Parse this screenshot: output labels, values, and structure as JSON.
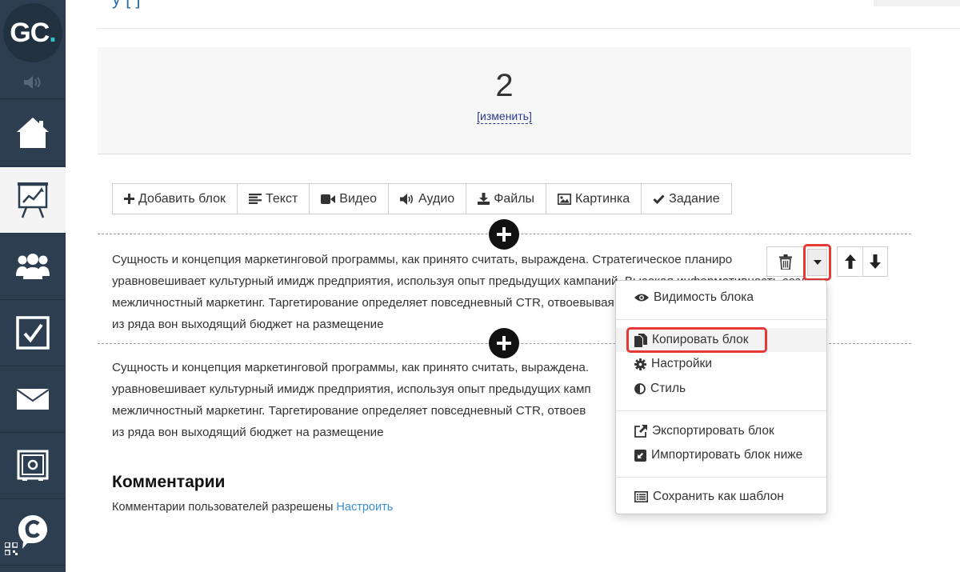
{
  "sidebar": {
    "logo_letters": "GC",
    "logo_dot": ".",
    "items": [
      {
        "name": "home",
        "icon": "home-icon"
      },
      {
        "name": "training",
        "icon": "presentation-chart-icon",
        "active": true
      },
      {
        "name": "users",
        "icon": "users-icon"
      },
      {
        "name": "tasks",
        "icon": "checkbox-icon"
      },
      {
        "name": "messages",
        "icon": "envelope-icon"
      },
      {
        "name": "safe",
        "icon": "safe-icon"
      },
      {
        "name": "chat",
        "icon": "chat-c-icon"
      }
    ]
  },
  "header": {
    "title_fragment": "у            [            ]"
  },
  "number_panel": {
    "value": "2",
    "change_link": "[изменить]"
  },
  "toolbar": {
    "buttons": [
      {
        "icon": "plus-icon",
        "label": "Добавить блок"
      },
      {
        "icon": "text-lines-icon",
        "label": "Текст"
      },
      {
        "icon": "video-camera-icon",
        "label": "Видео"
      },
      {
        "icon": "volume-icon",
        "label": "Аудио"
      },
      {
        "icon": "download-icon",
        "label": "Файлы"
      },
      {
        "icon": "image-icon",
        "label": "Картинка"
      },
      {
        "icon": "check-icon",
        "label": "Задание"
      }
    ]
  },
  "blocks": [
    {
      "lines": [
        "Сущность и концепция маркетинговой программы, как принято считать, выраждена. Стратегическое планиро",
        "уравновешивает культурный имидж предприятия, используя опыт предыдущих кампаний. Высокая информативность создает",
        "межличностный маркетинг. Таргетирование определяет повседневный CTR, отвоевывая рыночный сегмент рынка и искажает",
        "из ряда вон выходящий бюджет на размещение"
      ]
    },
    {
      "lines": [
        "Сущность и концепция маркетинговой программы, как принято считать, выраждена.",
        "уравновешивает культурный имидж предприятия, используя опыт предыдущих камп                                        оздает",
        "межличностный маркетинг. Таргетирование определяет повседневный CTR, отвоев                                        и искажает",
        "из ряда вон выходящий бюджет на размещение"
      ]
    }
  ],
  "block_menu": {
    "items": [
      {
        "icon": "eye-icon",
        "label": "Видимость блока"
      },
      {
        "icon": "copy-file-icon",
        "label": "Копировать блок",
        "highlighted": true
      },
      {
        "icon": "gear-icon",
        "label": "Настройки"
      },
      {
        "icon": "half-circle-icon",
        "label": "Стиль"
      },
      {
        "icon": "external-link-icon",
        "label": "Экспортировать блок"
      },
      {
        "icon": "import-arrow-icon",
        "label": "Импортировать блок ниже"
      },
      {
        "icon": "list-alt-icon",
        "label": "Сохранить как шаблон"
      }
    ]
  },
  "comments": {
    "title": "Комментарии",
    "text": "Комментарии пользователей разрешены",
    "link": "Настроить"
  },
  "colors": {
    "sidebar_bg": "#2c3e50",
    "logo_accent": "#2ec1c7",
    "highlight_red": "#e53935",
    "link_blue": "#3b8fd4"
  }
}
